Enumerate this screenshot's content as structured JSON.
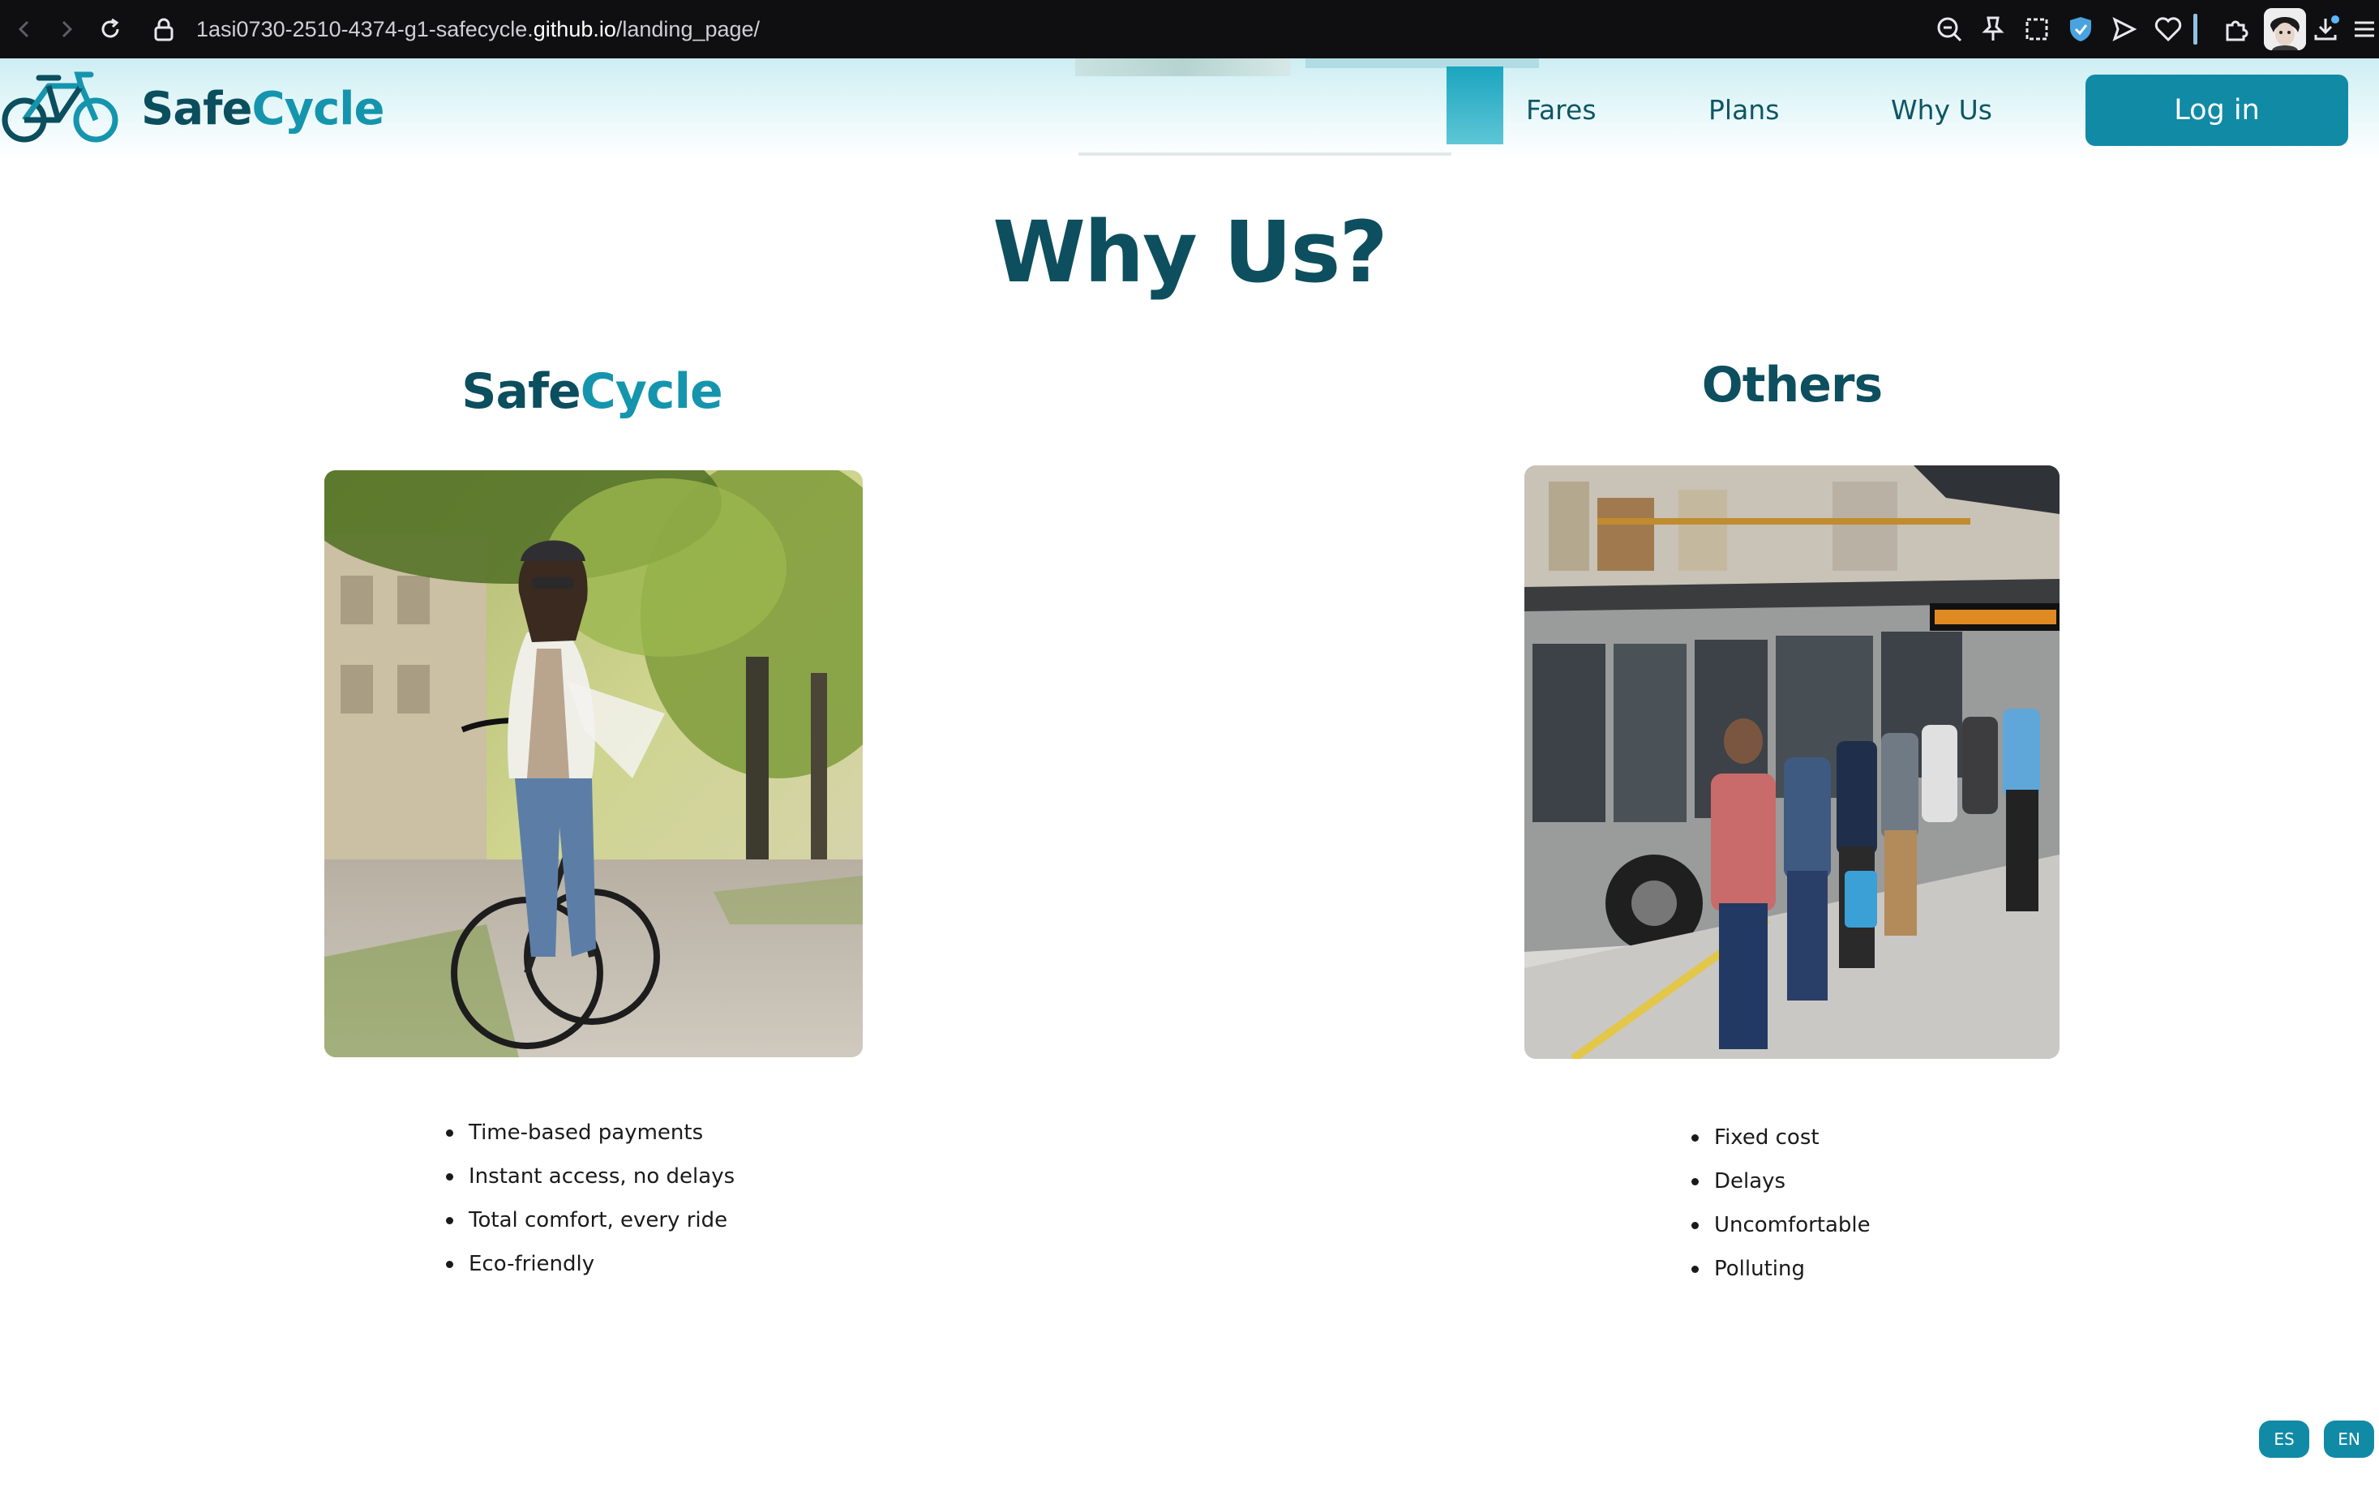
{
  "browser": {
    "url_prefix": "1asi0730-2510-4374-g1-safecycle.",
    "url_host": "github.io",
    "url_path": "/landing_page/",
    "icons": [
      "back-icon",
      "forward-icon",
      "reload-icon",
      "lock-icon",
      "zoom-out-icon",
      "pin-icon",
      "screenshot-icon",
      "shield-icon",
      "send-icon",
      "heart-icon",
      "extensions-icon",
      "avatar",
      "download-icon",
      "menu-icon"
    ]
  },
  "header": {
    "brand_part1": "Safe",
    "brand_part2": "Cycle",
    "nav": [
      {
        "label": "Fares"
      },
      {
        "label": "Plans"
      },
      {
        "label": "Why Us"
      }
    ],
    "login_label": "Log in"
  },
  "main": {
    "title": "Why Us?",
    "safecycle": {
      "heading_part1": "Safe",
      "heading_part2": "Cycle",
      "features": [
        "Time-based payments",
        "Instant access, no delays",
        "Total comfort, every ride",
        "Eco-friendly"
      ]
    },
    "others": {
      "heading": "Others",
      "features": [
        "Fixed cost",
        "Delays",
        "Uncomfortable",
        "Polluting"
      ]
    }
  },
  "language": {
    "es_label": "ES",
    "en_label": "EN"
  },
  "colors": {
    "brand_dark": "#0b4e5e",
    "brand_accent": "#1595ad",
    "button": "#118aa6"
  }
}
